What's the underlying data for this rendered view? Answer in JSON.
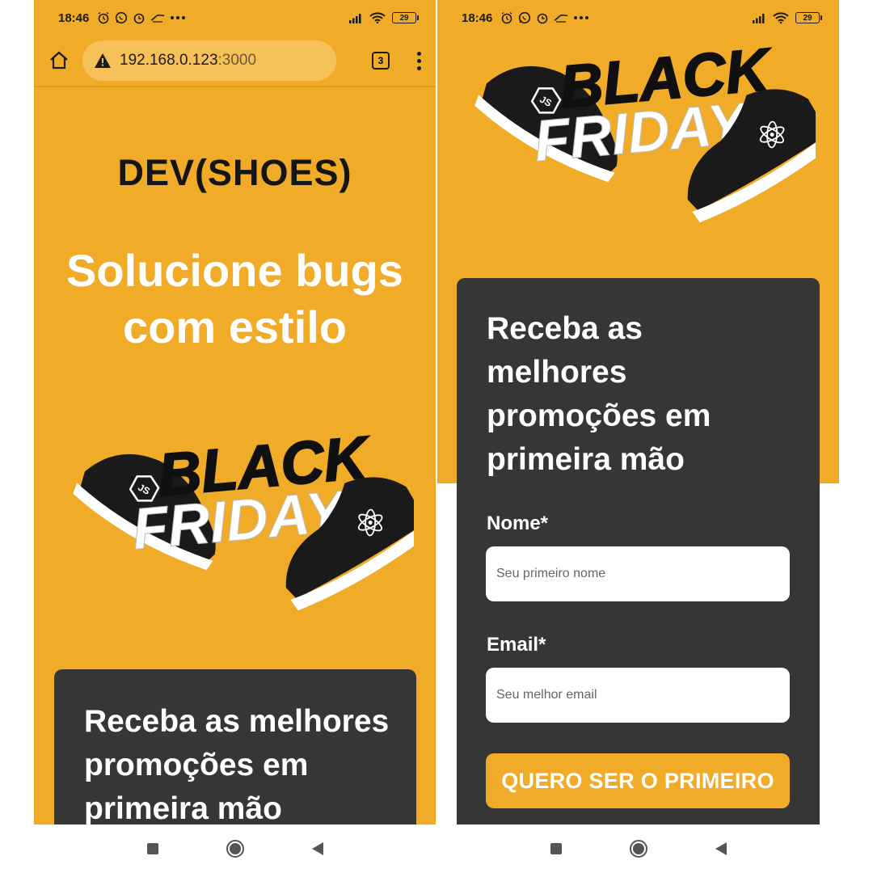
{
  "status_bar": {
    "time": "18:46",
    "battery": "29",
    "icons": [
      "alarm-icon",
      "whatsapp-icon",
      "clock-icon",
      "ifood-icon",
      "more-icon",
      "signal-icon",
      "wifi-icon",
      "battery-icon"
    ]
  },
  "browser": {
    "url_host": "192.168.0.123",
    "url_port": ":3000",
    "tab_count": "3"
  },
  "page": {
    "logo": "DEV(SHOES)",
    "hero_line1": "Solucione bugs",
    "hero_line2": "com estilo",
    "promo_title": "Receba as melhores promoções em primeira mão",
    "form": {
      "name_label": "Nome*",
      "name_placeholder": "Seu primeiro nome",
      "email_label": "Email*",
      "email_placeholder": "Seu melhor email",
      "submit_label": "QUERO SER O PRIMEIRO"
    },
    "art": {
      "word1": "BLACK",
      "word2": "FRIDAY",
      "left_shoe_logo": "JS",
      "colors": {
        "brand": "#f0ab28",
        "card": "#363636",
        "shoe": "#1a1a1a"
      }
    }
  }
}
